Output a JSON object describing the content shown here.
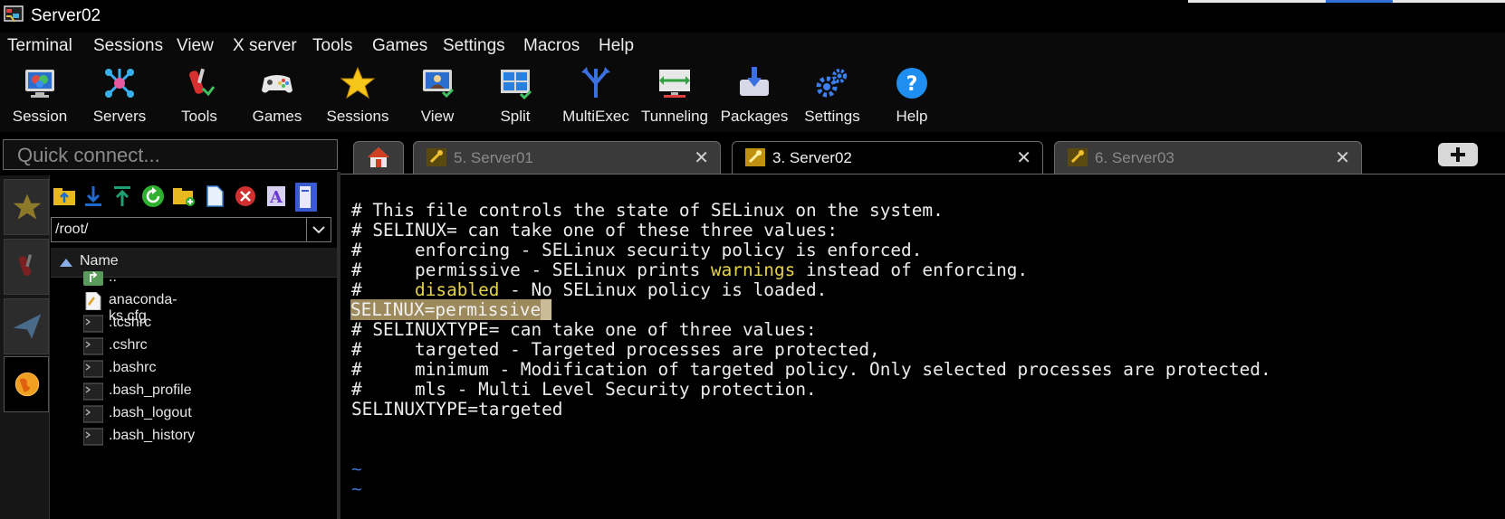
{
  "window": {
    "title": "Server02"
  },
  "menu": [
    "Terminal",
    "Sessions",
    "View",
    "X server",
    "Tools",
    "Games",
    "Settings",
    "Macros",
    "Help"
  ],
  "toolbar": [
    {
      "label": "Session",
      "icon": "session-icon"
    },
    {
      "label": "Servers",
      "icon": "servers-icon"
    },
    {
      "label": "Tools",
      "icon": "tools-icon"
    },
    {
      "label": "Games",
      "icon": "gamepad-icon"
    },
    {
      "label": "Sessions",
      "icon": "star-icon"
    },
    {
      "label": "View",
      "icon": "view-icon"
    },
    {
      "label": "Split",
      "icon": "split-icon"
    },
    {
      "label": "MultiExec",
      "icon": "multiexec-icon"
    },
    {
      "label": "Tunneling",
      "icon": "tunneling-icon"
    },
    {
      "label": "Packages",
      "icon": "packages-icon"
    },
    {
      "label": "Settings",
      "icon": "gears-icon"
    },
    {
      "label": "Help",
      "icon": "help-icon"
    }
  ],
  "quick_connect": {
    "placeholder": "Quick connect..."
  },
  "sidebar": {
    "tabs": [
      "star-icon",
      "tools-icon",
      "send-icon",
      "globe-icon"
    ],
    "path": "/root/",
    "column": "Name",
    "files": [
      {
        "name": "..",
        "icon": "folder-up-icon"
      },
      {
        "name": "anaconda-ks.cfg",
        "icon": "file-icon"
      },
      {
        "name": ".tcshrc",
        "icon": "terminal-file-icon"
      },
      {
        "name": ".cshrc",
        "icon": "terminal-file-icon"
      },
      {
        "name": ".bashrc",
        "icon": "terminal-file-icon"
      },
      {
        "name": ".bash_profile",
        "icon": "terminal-file-icon"
      },
      {
        "name": ".bash_logout",
        "icon": "terminal-file-icon"
      },
      {
        "name": ".bash_history",
        "icon": "terminal-file-icon"
      }
    ]
  },
  "tabs": [
    {
      "label": "5. Server01",
      "active": false
    },
    {
      "label": "3. Server02",
      "active": true
    },
    {
      "label": "6. Server03",
      "active": false
    }
  ],
  "terminal": {
    "lines": [
      "# This file controls the state of SELinux on the system.",
      "# SELINUX= can take one of these three values:",
      "#     enforcing - SELinux security policy is enforced.",
      {
        "pre": "#     permissive - SELinux prints ",
        "hl": "warnings",
        "post": " instead of enforcing."
      },
      {
        "pre": "#     ",
        "hl": "disabled",
        "post": " - No SELinux policy is loaded."
      },
      "SELINUX=permissive",
      "# SELINUXTYPE= can take one of three values:",
      "#     targeted - Targeted processes are protected,",
      "#     minimum - Modification of targeted policy. Only selected processes are protected.",
      "#     mls - Multi Level Security protection.",
      "SELINUXTYPE=targeted",
      "",
      "",
      "~",
      "~"
    ]
  }
}
